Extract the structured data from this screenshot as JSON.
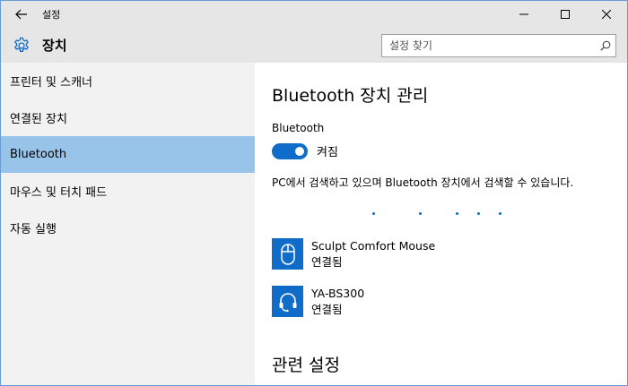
{
  "window": {
    "title": "설정"
  },
  "header": {
    "page_title": "장치"
  },
  "search": {
    "placeholder": "설정 찾기"
  },
  "sidebar": {
    "items": [
      {
        "label": "프린터 및 스캐너",
        "selected": false
      },
      {
        "label": "연결된 장치",
        "selected": false
      },
      {
        "label": "Bluetooth",
        "selected": true
      },
      {
        "label": "마우스 및 터치 패드",
        "selected": false
      },
      {
        "label": "자동 실행",
        "selected": false
      }
    ]
  },
  "main": {
    "heading": "Bluetooth 장치 관리",
    "bluetooth_label": "Bluetooth",
    "toggle": {
      "state": "on",
      "label": "켜짐"
    },
    "status_text": "PC에서 검색하고 있으며 Bluetooth 장치에서 검색할 수 있습니다.",
    "devices": [
      {
        "name": "Sculpt Comfort Mouse",
        "status": "연결됨",
        "icon": "mouse-icon"
      },
      {
        "name": "YA-BS300",
        "status": "연결됨",
        "icon": "headset-icon"
      }
    ],
    "related_heading": "관련 설정"
  },
  "colors": {
    "accent": "#0f6cc8",
    "selected_nav": "#99c4ea",
    "chrome": "#e6e6e6",
    "sidebar": "#f2f2f2"
  }
}
